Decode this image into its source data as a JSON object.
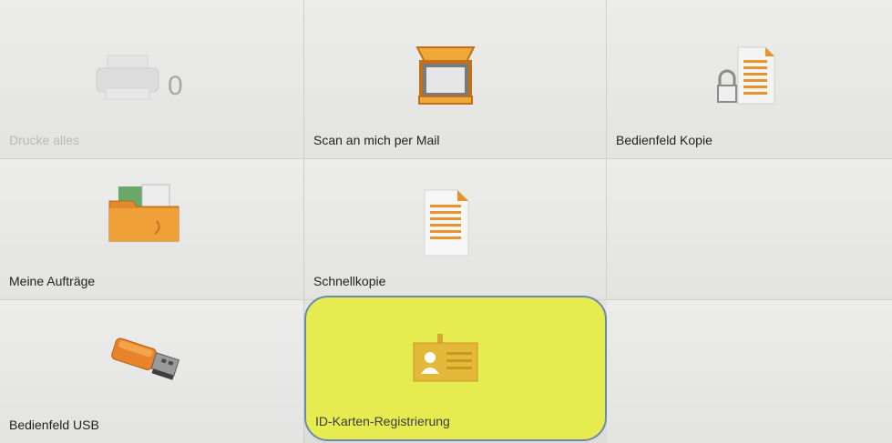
{
  "tiles": {
    "print_all": {
      "label": "Drucke alles",
      "count": "0"
    },
    "scan_to_me": {
      "label": "Scan an mich per Mail"
    },
    "panel_copy": {
      "label": "Bedienfeld Kopie"
    },
    "my_jobs": {
      "label": "Meine Aufträge"
    },
    "quick_copy": {
      "label": "Schnellkopie"
    },
    "panel_usb": {
      "label": "Bedienfeld USB"
    },
    "id_card": {
      "label": "ID-Karten-Registrierung"
    }
  },
  "colors": {
    "highlight": "#e6ec4f",
    "highlight_border": "#6d8aa8",
    "accent_orange": "#e8932b"
  },
  "icons": {
    "print_all": "printer-icon",
    "scan_to_me": "scanner-icon",
    "panel_copy": "locked-document-icon",
    "my_jobs": "folder-icon",
    "quick_copy": "document-icon",
    "panel_usb": "usb-stick-icon",
    "id_card": "id-card-icon"
  }
}
